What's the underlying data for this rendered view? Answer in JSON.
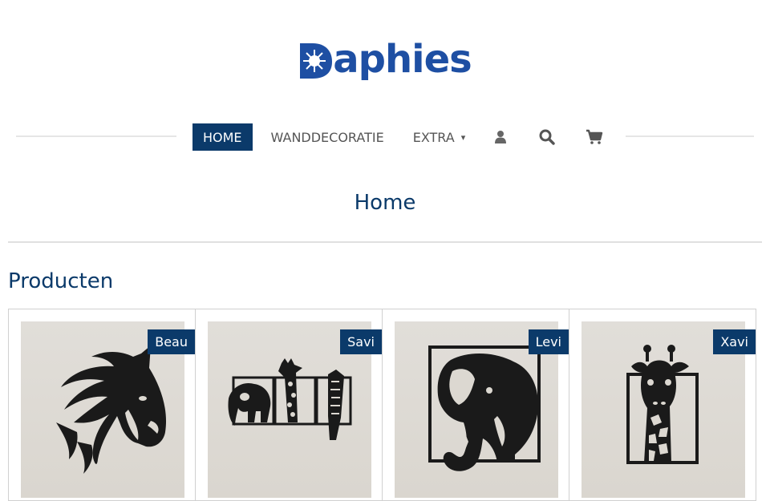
{
  "brand": {
    "name": "Daphies",
    "rest_text": "aphies",
    "color": "#1e4fa3"
  },
  "nav": {
    "items": [
      {
        "label": "HOME",
        "active": true
      },
      {
        "label": "WANDDECORATIE",
        "active": false
      },
      {
        "label": "EXTRA",
        "active": false,
        "has_dropdown": true,
        "caret": "▾"
      }
    ],
    "icons": [
      "user-icon",
      "search-icon",
      "cart-icon"
    ]
  },
  "page": {
    "title": "Home",
    "section_title": "Producten"
  },
  "products": [
    {
      "name": "Beau",
      "image": "horse-head-wall-art"
    },
    {
      "name": "Savi",
      "image": "animals-triptych-wall-art"
    },
    {
      "name": "Levi",
      "image": "elephant-framed-wall-art"
    },
    {
      "name": "Xavi",
      "image": "giraffe-framed-wall-art"
    }
  ],
  "colors": {
    "primary": "#0b3a6a",
    "nav_text": "#555555",
    "divider": "#e0e0e0"
  }
}
